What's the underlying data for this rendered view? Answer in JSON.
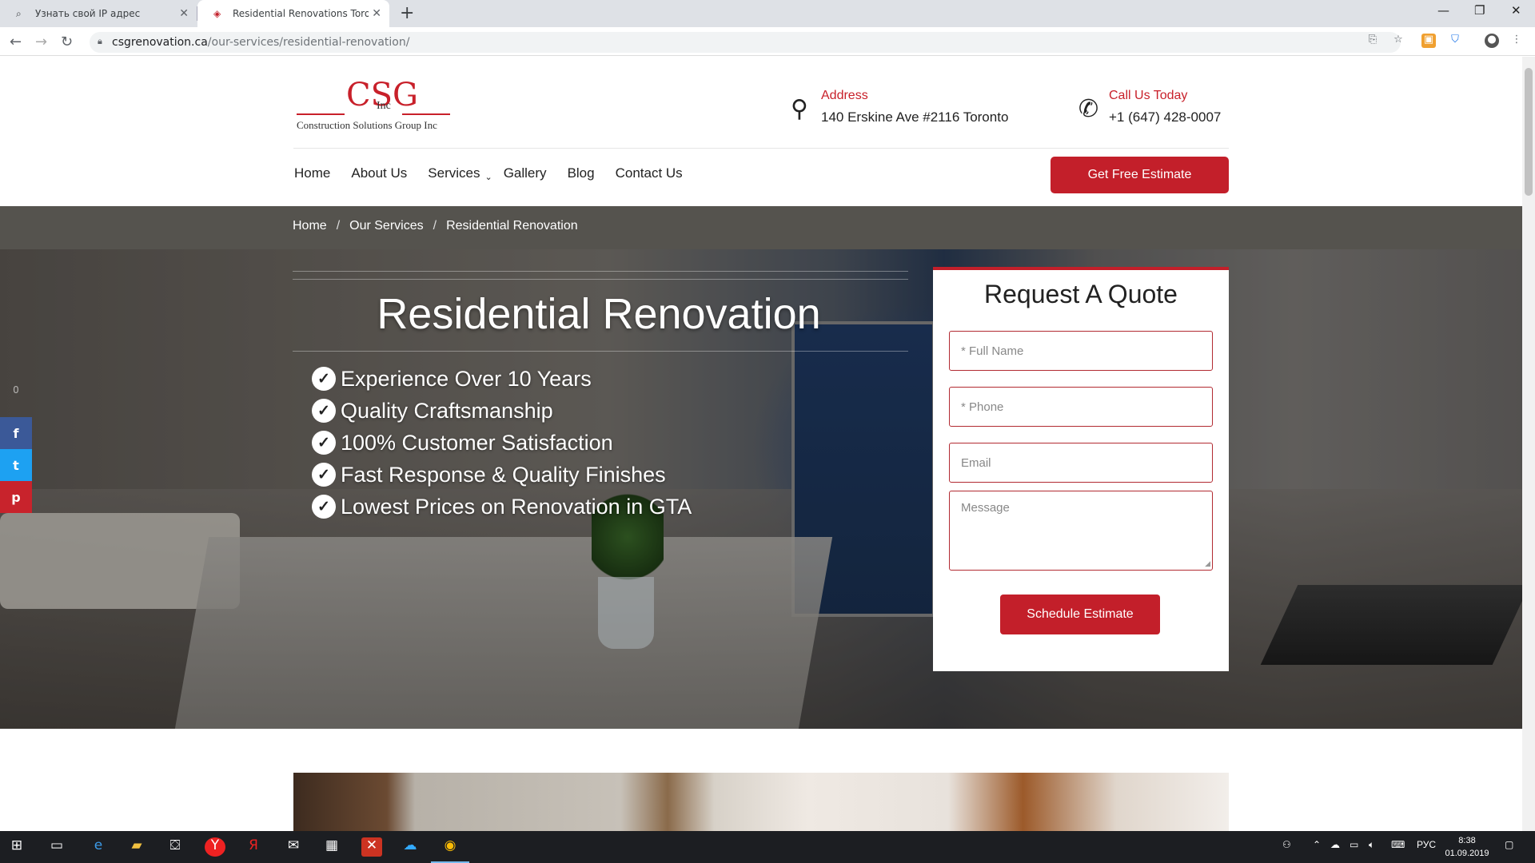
{
  "browser": {
    "tabs": [
      {
        "title": "Узнать свой IP адрес",
        "active": false
      },
      {
        "title": "Residential Renovations Toronto",
        "active": true
      }
    ],
    "url_host": "csgrenovation.ca",
    "url_path": "/our-services/residential-renovation/",
    "icons": [
      "back-icon",
      "forward-icon",
      "reload-icon",
      "lock-icon",
      "translate-icon",
      "star-icon",
      "extension-icon",
      "shield-icon",
      "profile-icon",
      "menu-icon"
    ]
  },
  "header": {
    "logo": {
      "mark": "CSG",
      "inc": "Inc",
      "tagline": "Construction Solutions Group Inc"
    },
    "address": {
      "label": "Address",
      "value": "140 Erskine Ave #2116 Toronto"
    },
    "phone": {
      "label": "Call Us Today",
      "value": "+1 (647) 428-0007"
    },
    "nav": [
      "Home",
      "About Us",
      "Services",
      "Gallery",
      "Blog",
      "Contact Us"
    ],
    "estimate_button": "Get Free Estimate"
  },
  "breadcrumb": [
    "Home",
    "Our Services",
    "Residential Renovation"
  ],
  "hero": {
    "title": "Residential Renovation",
    "features": [
      "Experience Over 10 Years",
      "Quality Craftsmanship",
      "100% Customer Satisfaction",
      "Fast Response & Quality Finishes",
      "Lowest Prices on Renovation in GTA"
    ]
  },
  "social": {
    "share_count": "0",
    "buttons": [
      "f",
      "t",
      "p"
    ],
    "colors": {
      "facebook": "#3b5998",
      "twitter": "#1da1f2",
      "pinterest": "#c8232c"
    }
  },
  "quote": {
    "title": "Request A Quote",
    "fields": [
      {
        "placeholder": "* Full Name"
      },
      {
        "placeholder": "* Phone"
      },
      {
        "placeholder": "Email"
      },
      {
        "placeholder": "Message"
      }
    ],
    "submit": "Schedule Estimate"
  },
  "taskbar": {
    "language": "РУС",
    "time": "8:38",
    "date": "01.09.2019"
  },
  "colors": {
    "brand_red": "#c31f2a",
    "breadcrumb_bg": "#55534e"
  }
}
